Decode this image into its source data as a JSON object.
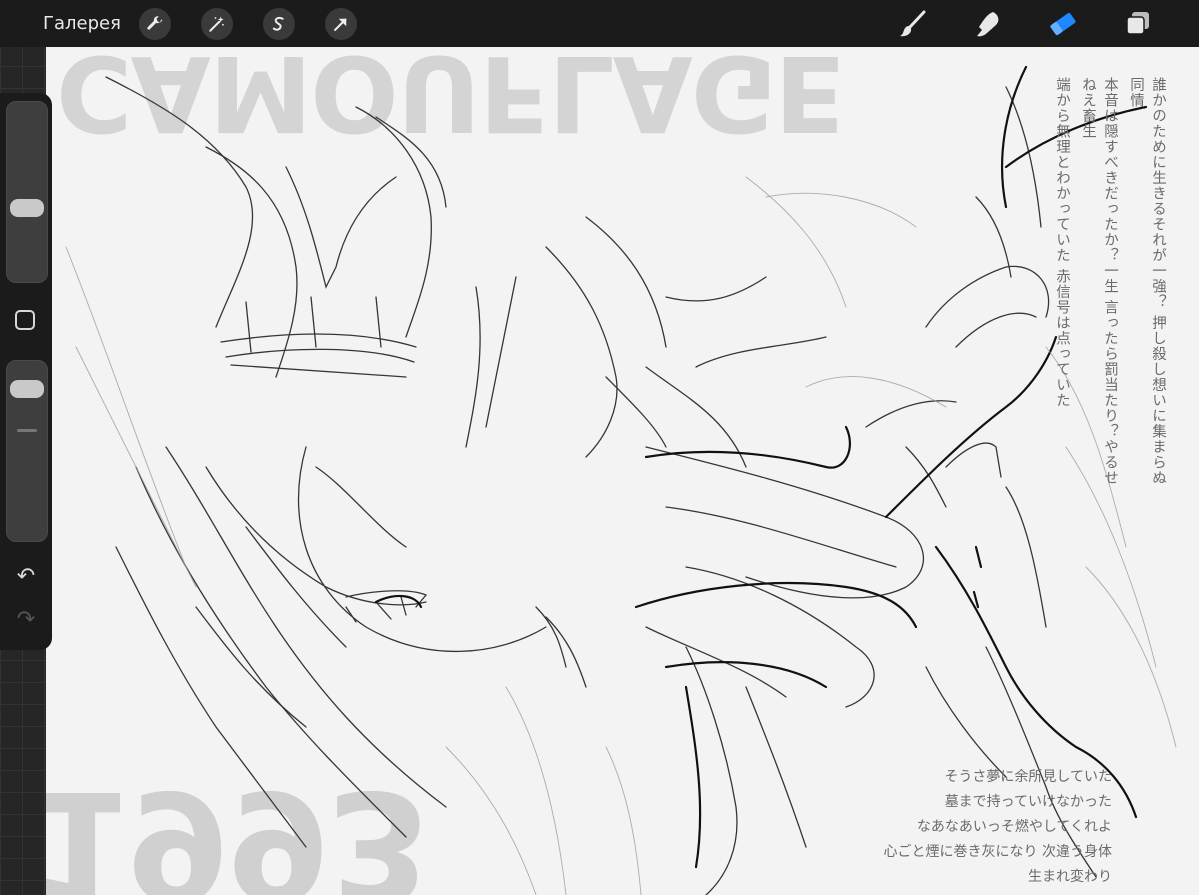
{
  "app": {
    "gallery_label": "Галерея"
  },
  "toolbar_left": [
    {
      "name": "wrench-icon"
    },
    {
      "name": "magic-wand-icon"
    },
    {
      "name": "selection-s-icon"
    },
    {
      "name": "move-arrow-icon"
    }
  ],
  "toolbar_right": [
    {
      "name": "brush-icon",
      "active": false
    },
    {
      "name": "smudge-icon",
      "active": false
    },
    {
      "name": "eraser-icon",
      "active": true
    },
    {
      "name": "layers-icon",
      "active": false
    }
  ],
  "colors": {
    "active_tool": "#1e88ff",
    "toolbar_bg": "#1b1b1b",
    "canvas_bg": "#f3f3f3"
  },
  "sidebar": {
    "brush_size_level": 0.4,
    "opacity_level": 0.1,
    "modify_button_icon": "square-icon",
    "undo_icon": "undo-icon",
    "redo_icon": "redo-icon",
    "undo_glyph": "↶",
    "redo_glyph": "↷"
  },
  "canvas": {
    "big_title": "CAMOUFLAGE",
    "big_bottom": "1993",
    "vertical_text": [
      "誰かのために生きるそれが一強？ 押し殺し想いに集まらぬ同情",
      "本音は隠すべきだったか？一生 言ったら罰当たり？やるせねえ畜生",
      "端から無理とわかっていた 赤信号は点っていた"
    ],
    "lyrics": [
      "そうさ夢に余所見していた",
      "墓まで持っていけなかった",
      "なあなあいっそ燃やしてくれよ",
      "心ごと煙に巻き灰になり 次違う身体",
      "生まれ変わり"
    ]
  }
}
